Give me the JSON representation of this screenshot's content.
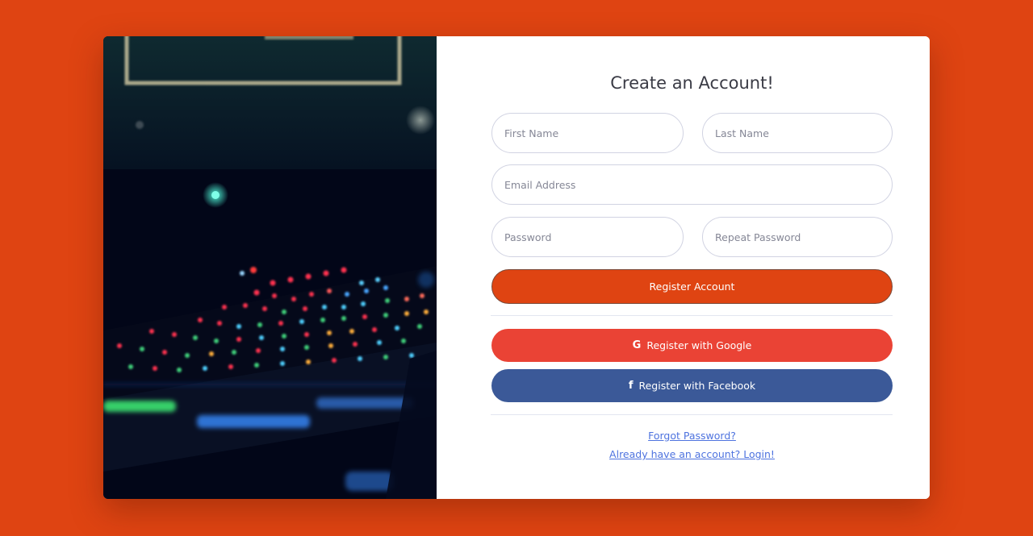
{
  "page": {
    "background_color": "#df4412"
  },
  "hero": {
    "description_icon": "keyboard-image"
  },
  "form": {
    "title": "Create an Account!",
    "first_name": {
      "placeholder": "First Name",
      "value": ""
    },
    "last_name": {
      "placeholder": "Last Name",
      "value": ""
    },
    "email": {
      "placeholder": "Email Address",
      "value": ""
    },
    "password": {
      "placeholder": "Password",
      "value": ""
    },
    "repeat_password": {
      "placeholder": "Repeat Password",
      "value": ""
    },
    "register_label": "Register Account",
    "google_label": "Register with Google",
    "google_icon": "G",
    "facebook_label": "Register with Facebook",
    "facebook_icon": "f",
    "forgot_password": "Forgot Password?",
    "login_link": "Already have an account? Login!"
  },
  "colors": {
    "primary": "#df4412",
    "google": "#ea4335",
    "facebook": "#3b5998",
    "link": "#4e73df"
  }
}
